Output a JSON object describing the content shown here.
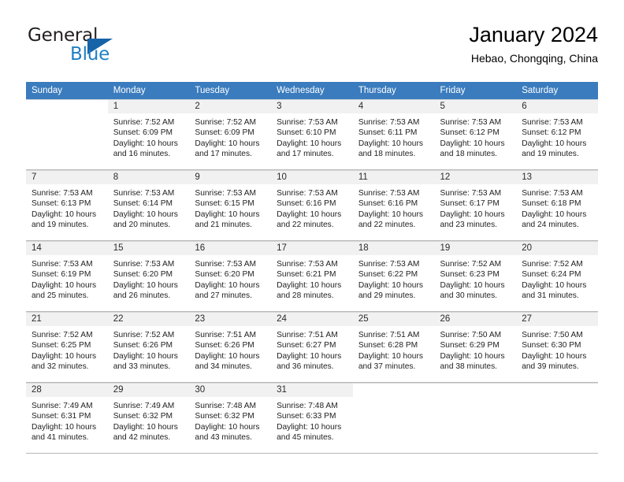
{
  "brand": {
    "word_one": "General",
    "word_two": "Blue",
    "logo_icon": "triangle-logo-icon",
    "accent_color": "#1663a8",
    "blue_text_color": "#1f7fc4"
  },
  "header": {
    "title": "January 2024",
    "subtitle": "Hebao, Chongqing, China"
  },
  "calendar": {
    "header_bg": "#3a7cbe",
    "header_text_color": "#ffffff",
    "daynum_band_bg": "#f1f1f1",
    "weekday_headers": [
      "Sunday",
      "Monday",
      "Tuesday",
      "Wednesday",
      "Thursday",
      "Friday",
      "Saturday"
    ],
    "weeks": [
      [
        {
          "day": "",
          "sunrise": "",
          "sunset": "",
          "daylight_line1": "",
          "daylight_line2": "",
          "blank": true
        },
        {
          "day": "1",
          "sunrise": "Sunrise: 7:52 AM",
          "sunset": "Sunset: 6:09 PM",
          "daylight_line1": "Daylight: 10 hours",
          "daylight_line2": "and 16 minutes."
        },
        {
          "day": "2",
          "sunrise": "Sunrise: 7:52 AM",
          "sunset": "Sunset: 6:09 PM",
          "daylight_line1": "Daylight: 10 hours",
          "daylight_line2": "and 17 minutes."
        },
        {
          "day": "3",
          "sunrise": "Sunrise: 7:53 AM",
          "sunset": "Sunset: 6:10 PM",
          "daylight_line1": "Daylight: 10 hours",
          "daylight_line2": "and 17 minutes."
        },
        {
          "day": "4",
          "sunrise": "Sunrise: 7:53 AM",
          "sunset": "Sunset: 6:11 PM",
          "daylight_line1": "Daylight: 10 hours",
          "daylight_line2": "and 18 minutes."
        },
        {
          "day": "5",
          "sunrise": "Sunrise: 7:53 AM",
          "sunset": "Sunset: 6:12 PM",
          "daylight_line1": "Daylight: 10 hours",
          "daylight_line2": "and 18 minutes."
        },
        {
          "day": "6",
          "sunrise": "Sunrise: 7:53 AM",
          "sunset": "Sunset: 6:12 PM",
          "daylight_line1": "Daylight: 10 hours",
          "daylight_line2": "and 19 minutes."
        }
      ],
      [
        {
          "day": "7",
          "sunrise": "Sunrise: 7:53 AM",
          "sunset": "Sunset: 6:13 PM",
          "daylight_line1": "Daylight: 10 hours",
          "daylight_line2": "and 19 minutes."
        },
        {
          "day": "8",
          "sunrise": "Sunrise: 7:53 AM",
          "sunset": "Sunset: 6:14 PM",
          "daylight_line1": "Daylight: 10 hours",
          "daylight_line2": "and 20 minutes."
        },
        {
          "day": "9",
          "sunrise": "Sunrise: 7:53 AM",
          "sunset": "Sunset: 6:15 PM",
          "daylight_line1": "Daylight: 10 hours",
          "daylight_line2": "and 21 minutes."
        },
        {
          "day": "10",
          "sunrise": "Sunrise: 7:53 AM",
          "sunset": "Sunset: 6:16 PM",
          "daylight_line1": "Daylight: 10 hours",
          "daylight_line2": "and 22 minutes."
        },
        {
          "day": "11",
          "sunrise": "Sunrise: 7:53 AM",
          "sunset": "Sunset: 6:16 PM",
          "daylight_line1": "Daylight: 10 hours",
          "daylight_line2": "and 22 minutes."
        },
        {
          "day": "12",
          "sunrise": "Sunrise: 7:53 AM",
          "sunset": "Sunset: 6:17 PM",
          "daylight_line1": "Daylight: 10 hours",
          "daylight_line2": "and 23 minutes."
        },
        {
          "day": "13",
          "sunrise": "Sunrise: 7:53 AM",
          "sunset": "Sunset: 6:18 PM",
          "daylight_line1": "Daylight: 10 hours",
          "daylight_line2": "and 24 minutes."
        }
      ],
      [
        {
          "day": "14",
          "sunrise": "Sunrise: 7:53 AM",
          "sunset": "Sunset: 6:19 PM",
          "daylight_line1": "Daylight: 10 hours",
          "daylight_line2": "and 25 minutes."
        },
        {
          "day": "15",
          "sunrise": "Sunrise: 7:53 AM",
          "sunset": "Sunset: 6:20 PM",
          "daylight_line1": "Daylight: 10 hours",
          "daylight_line2": "and 26 minutes."
        },
        {
          "day": "16",
          "sunrise": "Sunrise: 7:53 AM",
          "sunset": "Sunset: 6:20 PM",
          "daylight_line1": "Daylight: 10 hours",
          "daylight_line2": "and 27 minutes."
        },
        {
          "day": "17",
          "sunrise": "Sunrise: 7:53 AM",
          "sunset": "Sunset: 6:21 PM",
          "daylight_line1": "Daylight: 10 hours",
          "daylight_line2": "and 28 minutes."
        },
        {
          "day": "18",
          "sunrise": "Sunrise: 7:53 AM",
          "sunset": "Sunset: 6:22 PM",
          "daylight_line1": "Daylight: 10 hours",
          "daylight_line2": "and 29 minutes."
        },
        {
          "day": "19",
          "sunrise": "Sunrise: 7:52 AM",
          "sunset": "Sunset: 6:23 PM",
          "daylight_line1": "Daylight: 10 hours",
          "daylight_line2": "and 30 minutes."
        },
        {
          "day": "20",
          "sunrise": "Sunrise: 7:52 AM",
          "sunset": "Sunset: 6:24 PM",
          "daylight_line1": "Daylight: 10 hours",
          "daylight_line2": "and 31 minutes."
        }
      ],
      [
        {
          "day": "21",
          "sunrise": "Sunrise: 7:52 AM",
          "sunset": "Sunset: 6:25 PM",
          "daylight_line1": "Daylight: 10 hours",
          "daylight_line2": "and 32 minutes."
        },
        {
          "day": "22",
          "sunrise": "Sunrise: 7:52 AM",
          "sunset": "Sunset: 6:26 PM",
          "daylight_line1": "Daylight: 10 hours",
          "daylight_line2": "and 33 minutes."
        },
        {
          "day": "23",
          "sunrise": "Sunrise: 7:51 AM",
          "sunset": "Sunset: 6:26 PM",
          "daylight_line1": "Daylight: 10 hours",
          "daylight_line2": "and 34 minutes."
        },
        {
          "day": "24",
          "sunrise": "Sunrise: 7:51 AM",
          "sunset": "Sunset: 6:27 PM",
          "daylight_line1": "Daylight: 10 hours",
          "daylight_line2": "and 36 minutes."
        },
        {
          "day": "25",
          "sunrise": "Sunrise: 7:51 AM",
          "sunset": "Sunset: 6:28 PM",
          "daylight_line1": "Daylight: 10 hours",
          "daylight_line2": "and 37 minutes."
        },
        {
          "day": "26",
          "sunrise": "Sunrise: 7:50 AM",
          "sunset": "Sunset: 6:29 PM",
          "daylight_line1": "Daylight: 10 hours",
          "daylight_line2": "and 38 minutes."
        },
        {
          "day": "27",
          "sunrise": "Sunrise: 7:50 AM",
          "sunset": "Sunset: 6:30 PM",
          "daylight_line1": "Daylight: 10 hours",
          "daylight_line2": "and 39 minutes."
        }
      ],
      [
        {
          "day": "28",
          "sunrise": "Sunrise: 7:49 AM",
          "sunset": "Sunset: 6:31 PM",
          "daylight_line1": "Daylight: 10 hours",
          "daylight_line2": "and 41 minutes."
        },
        {
          "day": "29",
          "sunrise": "Sunrise: 7:49 AM",
          "sunset": "Sunset: 6:32 PM",
          "daylight_line1": "Daylight: 10 hours",
          "daylight_line2": "and 42 minutes."
        },
        {
          "day": "30",
          "sunrise": "Sunrise: 7:48 AM",
          "sunset": "Sunset: 6:32 PM",
          "daylight_line1": "Daylight: 10 hours",
          "daylight_line2": "and 43 minutes."
        },
        {
          "day": "31",
          "sunrise": "Sunrise: 7:48 AM",
          "sunset": "Sunset: 6:33 PM",
          "daylight_line1": "Daylight: 10 hours",
          "daylight_line2": "and 45 minutes."
        },
        {
          "day": "",
          "sunrise": "",
          "sunset": "",
          "daylight_line1": "",
          "daylight_line2": "",
          "blank": true
        },
        {
          "day": "",
          "sunrise": "",
          "sunset": "",
          "daylight_line1": "",
          "daylight_line2": "",
          "blank": true
        },
        {
          "day": "",
          "sunrise": "",
          "sunset": "",
          "daylight_line1": "",
          "daylight_line2": "",
          "blank": true
        }
      ]
    ]
  }
}
